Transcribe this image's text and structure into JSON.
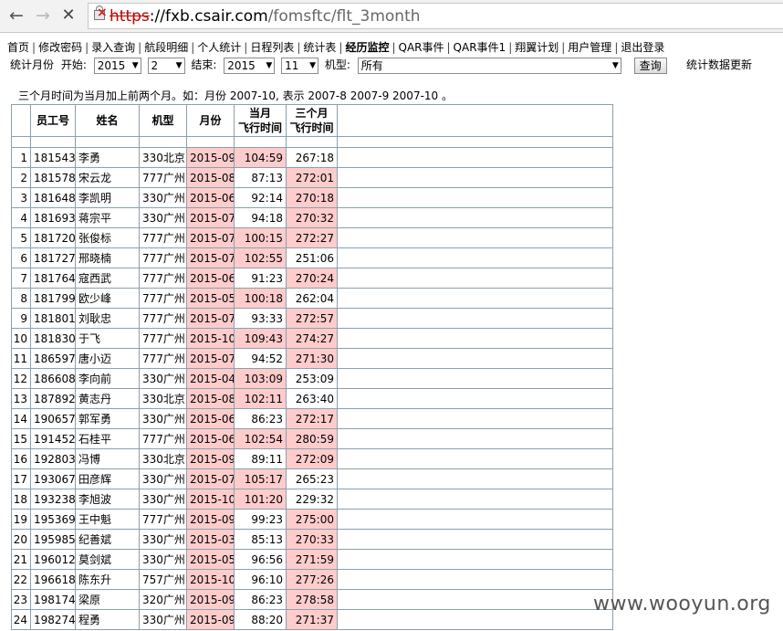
{
  "browser": {
    "url_protocol": "https",
    "url_separator": "://",
    "url_host": "fxb.csair.com",
    "url_path": "/fomsftc/flt_3month"
  },
  "menu": [
    {
      "label": "首页",
      "bold": false
    },
    {
      "label": "修改密码",
      "bold": false
    },
    {
      "label": "录入查询",
      "bold": false
    },
    {
      "label": "航段明细",
      "bold": false
    },
    {
      "label": "个人统计",
      "bold": false
    },
    {
      "label": "日程列表",
      "bold": false
    },
    {
      "label": "统计表",
      "bold": false
    },
    {
      "label": "经历监控",
      "bold": true
    },
    {
      "label": "QAR事件",
      "bold": false
    },
    {
      "label": "QAR事件1",
      "bold": false
    },
    {
      "label": "翔翼计划",
      "bold": false
    },
    {
      "label": "用户管理",
      "bold": false
    },
    {
      "label": "退出登录",
      "bold": false
    }
  ],
  "filter": {
    "month_label": "统计月份",
    "start_label": "开始:",
    "start_year": "2015",
    "start_month": "2",
    "end_label": "结束:",
    "end_year": "2015",
    "end_month": "11",
    "type_label": "机型:",
    "type_value": "所有",
    "query_button": "查询",
    "refresh_link": "统计数据更新"
  },
  "note": "三个月时间为当月加上前两个月。如：月份 2007-10, 表示 2007-8 2007-9 2007-10 。",
  "table": {
    "headers": {
      "id": "员工号",
      "name": "姓名",
      "type": "机型",
      "month": "月份",
      "cur_line1": "当月",
      "cur_line2": "飞行时间",
      "three_line1": "三个月",
      "three_line2": "飞行时间"
    },
    "rows": [
      {
        "n": "1",
        "id": "181543",
        "name": "李勇",
        "type": "330北京",
        "month": "2015-09",
        "cur": "104:59",
        "cur_hi": true,
        "three": "267:18",
        "three_hi": false
      },
      {
        "n": "2",
        "id": "181578",
        "name": "宋云龙",
        "type": "777广州",
        "month": "2015-08",
        "cur": "87:13",
        "cur_hi": false,
        "three": "272:01",
        "three_hi": true
      },
      {
        "n": "3",
        "id": "181648",
        "name": "李凯明",
        "type": "330广州",
        "month": "2015-06",
        "cur": "92:14",
        "cur_hi": false,
        "three": "270:18",
        "three_hi": true
      },
      {
        "n": "4",
        "id": "181693",
        "name": "蒋宗平",
        "type": "330广州",
        "month": "2015-07",
        "cur": "94:18",
        "cur_hi": false,
        "three": "270:32",
        "three_hi": true
      },
      {
        "n": "5",
        "id": "181720",
        "name": "张俊标",
        "type": "777广州",
        "month": "2015-07",
        "cur": "100:15",
        "cur_hi": true,
        "three": "272:27",
        "three_hi": true
      },
      {
        "n": "6",
        "id": "181727",
        "name": "邢晓楠",
        "type": "777广州",
        "month": "2015-07",
        "cur": "102:55",
        "cur_hi": true,
        "three": "251:06",
        "three_hi": false
      },
      {
        "n": "7",
        "id": "181764",
        "name": "寇西武",
        "type": "777广州",
        "month": "2015-06",
        "cur": "91:23",
        "cur_hi": false,
        "three": "270:24",
        "three_hi": true
      },
      {
        "n": "8",
        "id": "181799",
        "name": "欧少峰",
        "type": "777广州",
        "month": "2015-05",
        "cur": "100:18",
        "cur_hi": true,
        "three": "262:04",
        "three_hi": false
      },
      {
        "n": "9",
        "id": "181801",
        "name": "刘耿忠",
        "type": "777广州",
        "month": "2015-07",
        "cur": "93:33",
        "cur_hi": false,
        "three": "272:57",
        "three_hi": true
      },
      {
        "n": "10",
        "id": "181830",
        "name": "于飞",
        "type": "777广州",
        "month": "2015-10",
        "cur": "109:43",
        "cur_hi": true,
        "three": "274:27",
        "three_hi": true
      },
      {
        "n": "11",
        "id": "186597",
        "name": "唐小迈",
        "type": "777广州",
        "month": "2015-07",
        "cur": "94:52",
        "cur_hi": false,
        "three": "271:30",
        "three_hi": true
      },
      {
        "n": "12",
        "id": "186608",
        "name": "李向前",
        "type": "330广州",
        "month": "2015-04",
        "cur": "103:09",
        "cur_hi": true,
        "three": "253:09",
        "three_hi": false
      },
      {
        "n": "13",
        "id": "187892",
        "name": "黄志丹",
        "type": "330北京",
        "month": "2015-08",
        "cur": "102:11",
        "cur_hi": true,
        "three": "263:40",
        "three_hi": false
      },
      {
        "n": "14",
        "id": "190657",
        "name": "郭军勇",
        "type": "330广州",
        "month": "2015-06",
        "cur": "86:23",
        "cur_hi": false,
        "three": "272:17",
        "three_hi": true
      },
      {
        "n": "15",
        "id": "191452",
        "name": "石桂平",
        "type": "777广州",
        "month": "2015-06",
        "cur": "102:54",
        "cur_hi": true,
        "three": "280:59",
        "three_hi": true
      },
      {
        "n": "16",
        "id": "192803",
        "name": "冯博",
        "type": "330北京",
        "month": "2015-09",
        "cur": "89:11",
        "cur_hi": false,
        "three": "272:09",
        "three_hi": true
      },
      {
        "n": "17",
        "id": "193067",
        "name": "田彦辉",
        "type": "330广州",
        "month": "2015-07",
        "cur": "105:17",
        "cur_hi": true,
        "three": "265:23",
        "three_hi": false
      },
      {
        "n": "18",
        "id": "193238",
        "name": "李旭波",
        "type": "330广州",
        "month": "2015-10",
        "cur": "101:20",
        "cur_hi": true,
        "three": "229:32",
        "three_hi": false
      },
      {
        "n": "19",
        "id": "195369",
        "name": "王中魁",
        "type": "777广州",
        "month": "2015-09",
        "cur": "99:23",
        "cur_hi": false,
        "three": "275:00",
        "three_hi": true
      },
      {
        "n": "20",
        "id": "195985",
        "name": "纪善斌",
        "type": "330广州",
        "month": "2015-03",
        "cur": "85:13",
        "cur_hi": false,
        "three": "270:33",
        "three_hi": true
      },
      {
        "n": "21",
        "id": "196012",
        "name": "莫剑斌",
        "type": "330广州",
        "month": "2015-05",
        "cur": "96:56",
        "cur_hi": false,
        "three": "271:59",
        "three_hi": true
      },
      {
        "n": "22",
        "id": "196618",
        "name": "陈东升",
        "type": "757广州",
        "month": "2015-10",
        "cur": "96:10",
        "cur_hi": false,
        "three": "277:26",
        "three_hi": true
      },
      {
        "n": "23",
        "id": "198174",
        "name": "梁原",
        "type": "320广州",
        "month": "2015-09",
        "cur": "86:23",
        "cur_hi": false,
        "three": "278:58",
        "three_hi": true
      },
      {
        "n": "24",
        "id": "198274",
        "name": "程勇",
        "type": "330广州",
        "month": "2015-09",
        "cur": "88:20",
        "cur_hi": false,
        "three": "271:37",
        "three_hi": true
      }
    ]
  },
  "watermark": "www.wooyun.org",
  "colors": {
    "highlight": "#ffcccc",
    "grid_line": "#8aa0ae"
  }
}
